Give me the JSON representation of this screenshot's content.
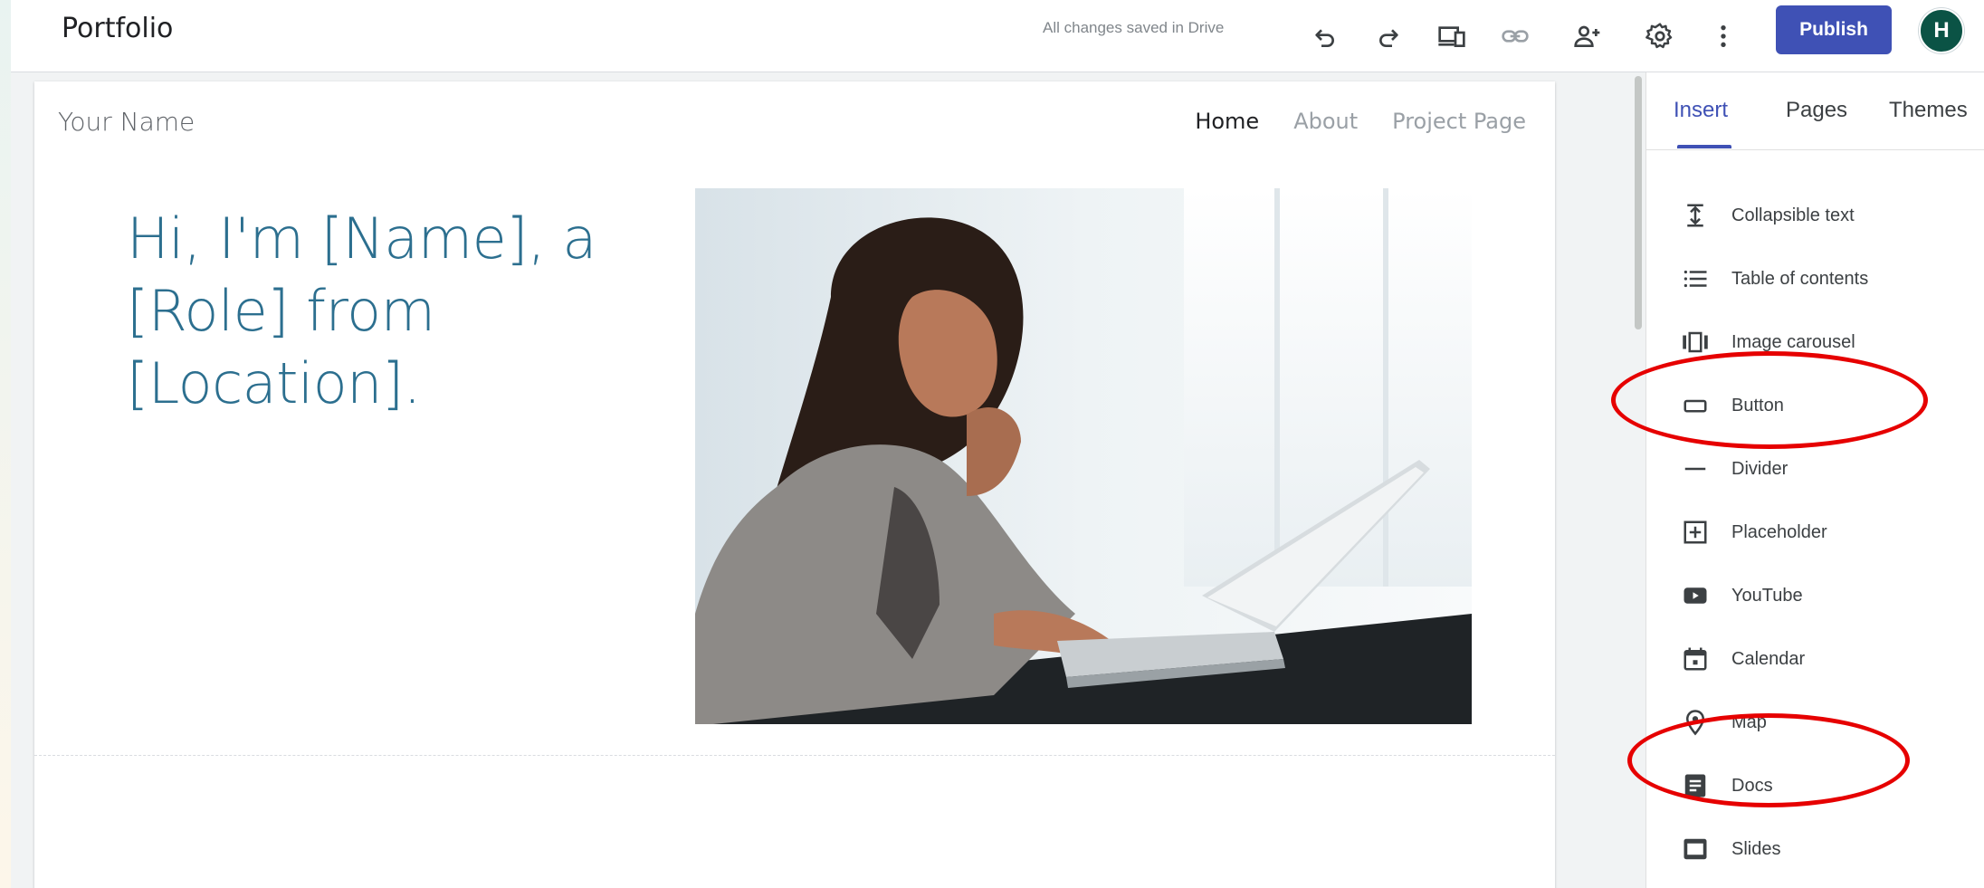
{
  "topbar": {
    "site_title": "Portfolio",
    "save_status": "All changes saved in Drive",
    "publish_label": "Publish",
    "avatar_initial": "H",
    "accent_color": "#3f51b5"
  },
  "site": {
    "brand_name": "Your Name",
    "nav": [
      "Home",
      "About",
      "Project Page"
    ],
    "active_nav": "Home",
    "hero_heading": "Hi, I'm [Name], a [Role] from [Location]."
  },
  "panel": {
    "tabs": [
      "Insert",
      "Pages",
      "Themes"
    ],
    "active_tab": "Insert",
    "items": [
      {
        "label": "Collapsible text",
        "icon": "collapsible-text-icon"
      },
      {
        "label": "Table of contents",
        "icon": "table-of-contents-icon"
      },
      {
        "label": "Image carousel",
        "icon": "image-carousel-icon"
      },
      {
        "label": "Button",
        "icon": "button-icon"
      },
      {
        "label": "Divider",
        "icon": "divider-icon"
      },
      {
        "label": "Placeholder",
        "icon": "placeholder-icon"
      },
      {
        "label": "YouTube",
        "icon": "youtube-icon"
      },
      {
        "label": "Calendar",
        "icon": "calendar-icon"
      },
      {
        "label": "Map",
        "icon": "map-icon"
      },
      {
        "label": "Docs",
        "icon": "docs-icon"
      },
      {
        "label": "Slides",
        "icon": "slides-icon"
      }
    ]
  },
  "annotations": {
    "color": "#e60000",
    "highlighted_items": [
      "Button",
      "Docs"
    ]
  }
}
